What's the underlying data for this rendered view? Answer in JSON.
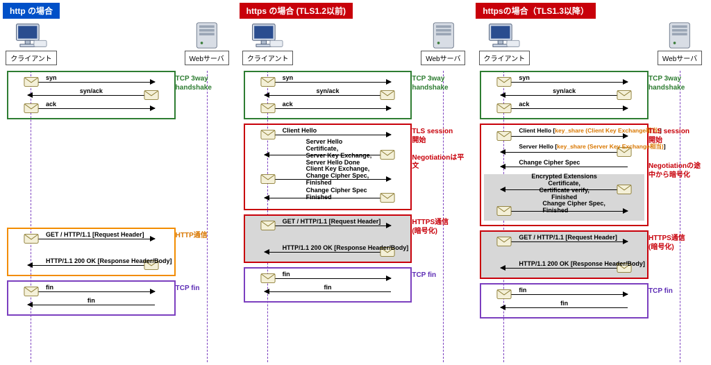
{
  "columns": [
    {
      "title": "http の場合",
      "titleClass": "blue-bg",
      "actors": {
        "left": "クライアント",
        "right": "Webサーバ"
      },
      "groups": [
        {
          "style": "green",
          "label": "TCP 3way\nhandshake",
          "messages": [
            {
              "dir": "r",
              "text": "syn",
              "textPos": "left-txt"
            },
            {
              "dir": "l",
              "text": "syn/ack",
              "textPos": "center-txt"
            },
            {
              "dir": "r",
              "text": "ack",
              "textPos": "left-txt"
            }
          ]
        },
        {
          "spacer": 150
        },
        {
          "style": "orange",
          "label": "HTTP通信",
          "messages": [
            {
              "dir": "r",
              "text": "GET / HTTP/1.1 [Request Header]",
              "textPos": "left-txt"
            },
            {
              "gap": 18
            },
            {
              "dir": "l",
              "text": "HTTP/1.1 200 OK [Response Header/Body]",
              "textPos": "left-txt"
            }
          ]
        },
        {
          "style": "purple",
          "label": "TCP fin",
          "messages": [
            {
              "dir": "r",
              "text": "fin",
              "textPos": "left-txt"
            },
            {
              "dir": "l",
              "text": "fin",
              "textPos": "center-txt",
              "noEnv": true
            }
          ]
        }
      ]
    },
    {
      "title": "https の場合 (TLS1.2以前)",
      "titleClass": "red-bg",
      "actors": {
        "left": "クライアント",
        "right": "Webサーバ"
      },
      "groups": [
        {
          "style": "green",
          "label": "TCP 3way\nhandshake",
          "messages": [
            {
              "dir": "r",
              "text": "syn",
              "textPos": "left-txt"
            },
            {
              "dir": "l",
              "text": "syn/ack",
              "textPos": "center-txt"
            },
            {
              "dir": "r",
              "text": "ack",
              "textPos": "left-txt"
            }
          ]
        },
        {
          "style": "red",
          "label": "TLS session\n開始\n\nNegotiationは平文",
          "messages": [
            {
              "dir": "r",
              "text": "Client Hello",
              "textPos": "left-txt"
            },
            {
              "dir": "l",
              "multi": true,
              "text": "Server Hello\nCertificate,\nServer Key Exchange,\nServer Hello Done",
              "textPos": "left-txt",
              "tall": 38
            },
            {
              "dir": "r",
              "multi": true,
              "text": "Client Key Exchange,\nChange Cipher Spec,\nFinished",
              "textPos": "left-txt",
              "tall": 30
            },
            {
              "dir": "l",
              "multi": true,
              "text": "Change Cipher Spec\nFinished",
              "textPos": "left-txt",
              "tall": 22
            }
          ]
        },
        {
          "style": "red",
          "shaded": true,
          "label": "HTTPS通信\n(暗号化)",
          "messages": [
            {
              "dir": "r",
              "text": "GET / HTTP/1.1 [Request Header]",
              "textPos": "left-txt"
            },
            {
              "gap": 18
            },
            {
              "dir": "l",
              "text": "HTTP/1.1 200 OK [Response Header/Body]",
              "textPos": "left-txt"
            }
          ]
        },
        {
          "style": "purple",
          "label": "TCP fin",
          "messages": [
            {
              "dir": "r",
              "text": "fin",
              "textPos": "left-txt"
            },
            {
              "dir": "l",
              "text": "fin",
              "textPos": "center-txt",
              "noEnv": true
            }
          ]
        }
      ]
    },
    {
      "title": "httpsの場合（TLS1.3以降）",
      "titleClass": "red-bg",
      "actors": {
        "left": "クライアント",
        "right": "Webサーバ"
      },
      "groups": [
        {
          "style": "green",
          "label": "TCP 3way\nhandshake",
          "messages": [
            {
              "dir": "r",
              "text": "syn",
              "textPos": "left-txt"
            },
            {
              "dir": "l",
              "text": "syn/ack",
              "textPos": "center-txt"
            },
            {
              "dir": "r",
              "text": "ack",
              "textPos": "left-txt"
            }
          ]
        },
        {
          "style": "red",
          "label": "TLS session\n開始\n\n\nNegotiationの途中から暗号化",
          "messages": [
            {
              "dir": "r",
              "extHtml": "Client Hello [<span class='orange'>key_share (Client Key Exchange相当)</span>]",
              "textPos": "left-txt",
              "tall": 22
            },
            {
              "dir": "l",
              "extHtml": "Server Hello [<span class='orange'>key_share (Server Key Exchange相当)</span>]",
              "textPos": "left-txt",
              "tall": 22
            },
            {
              "dir": "l",
              "text": "Change Cipher Spec",
              "textPos": "left-txt",
              "noEnv": true
            },
            {
              "shadedBlock": true,
              "messages": [
                {
                  "dir": "l",
                  "multi": true,
                  "text": "Encrypted Extensions\nCertificate,\nCertificate verify,\nFinished",
                  "textPos": "center-txt",
                  "tall": 38
                },
                {
                  "dir": "r",
                  "multi": true,
                  "text": "Change Cipher Spec,\nFinished",
                  "textPos": "left-txt",
                  "tall": 22
                }
              ]
            }
          ]
        },
        {
          "style": "red",
          "shaded": true,
          "label": "HTTPS通信\n(暗号化)",
          "messages": [
            {
              "dir": "r",
              "text": "GET / HTTP/1.1 [Request Header]",
              "textPos": "left-txt"
            },
            {
              "gap": 18
            },
            {
              "dir": "l",
              "text": "HTTP/1.1 200 OK [Response Header/Body]",
              "textPos": "left-txt"
            }
          ]
        },
        {
          "style": "purple",
          "label": "TCP fin",
          "messages": [
            {
              "dir": "r",
              "text": "fin",
              "textPos": "left-txt"
            },
            {
              "dir": "l",
              "text": "fin",
              "textPos": "center-txt",
              "noEnv": true
            }
          ]
        }
      ]
    }
  ]
}
